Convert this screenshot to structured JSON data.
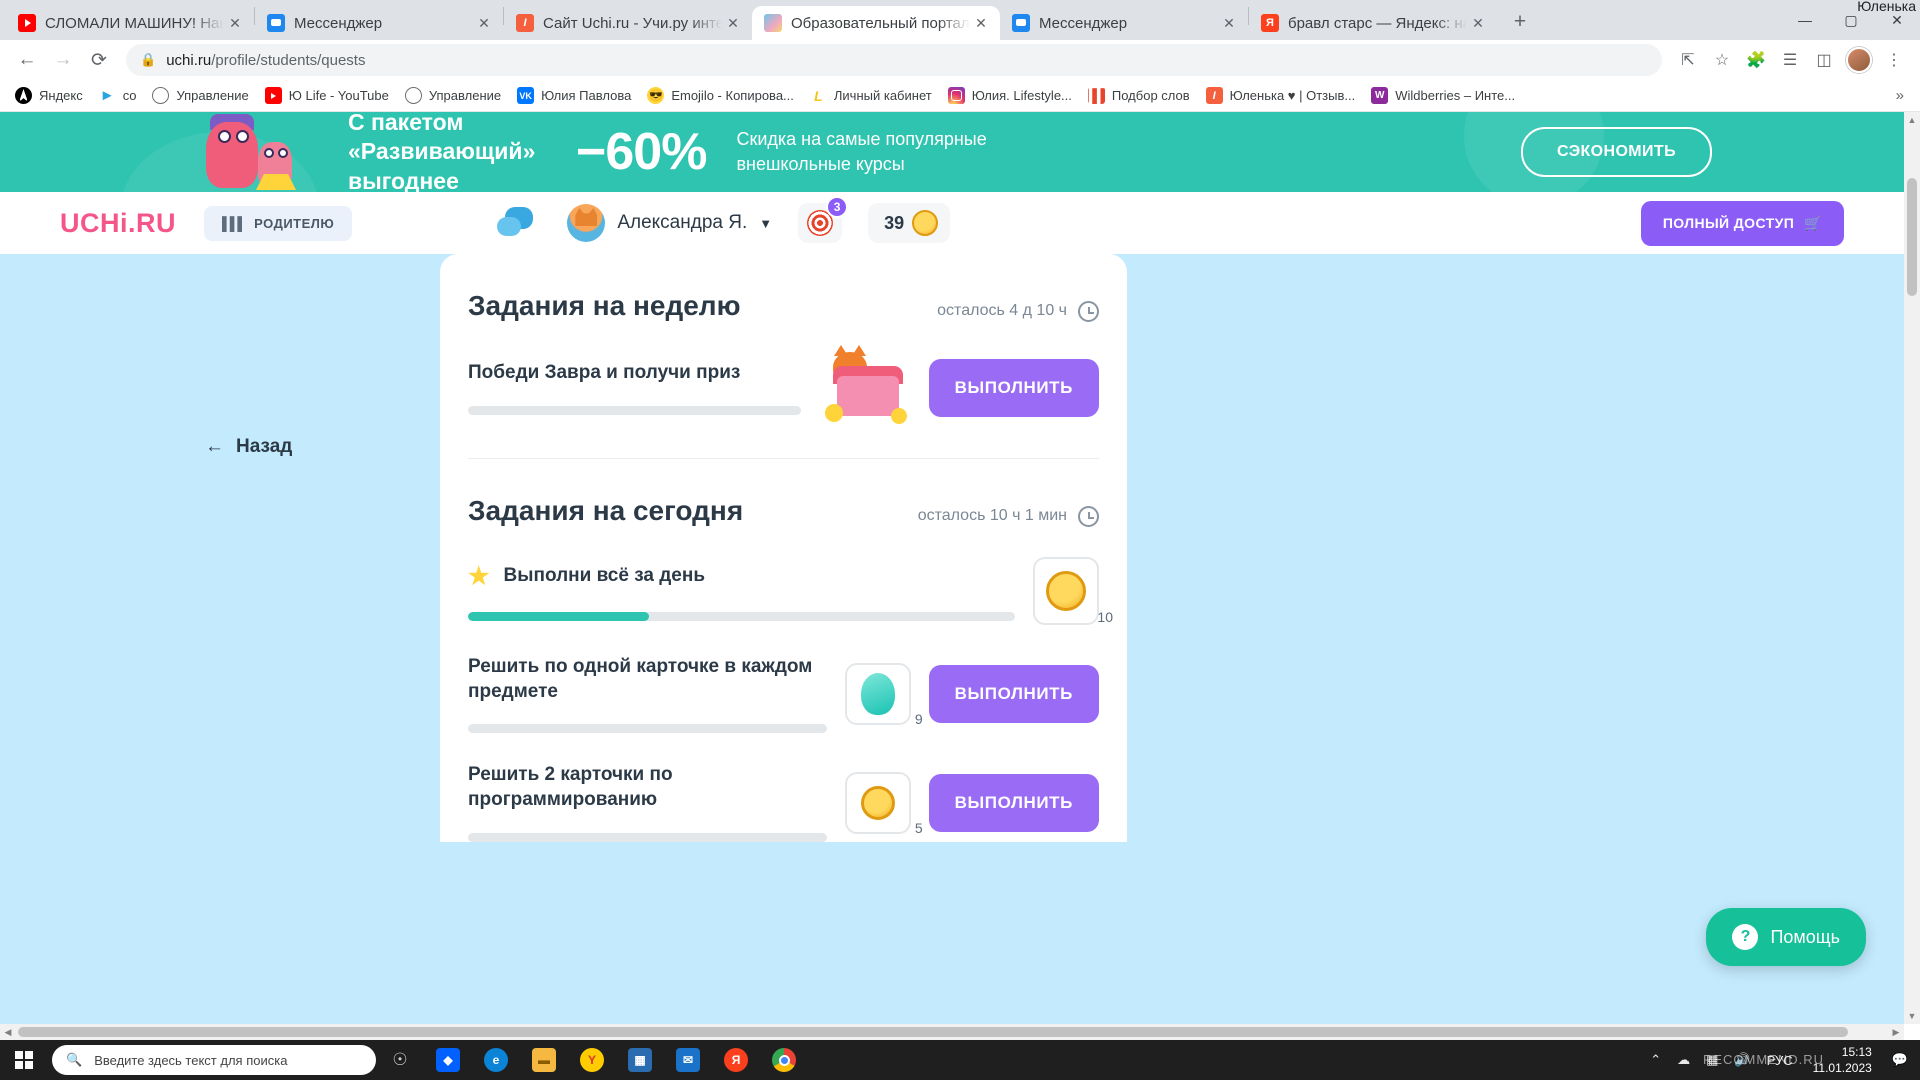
{
  "browser": {
    "tabs": [
      {
        "title": "СЛОМАЛИ МАШИНУ! Наш",
        "favicon": "youtube-icon",
        "active": false
      },
      {
        "title": "Мессенджер",
        "favicon": "messenger-icon",
        "active": false
      },
      {
        "title": "Сайт Uchi.ru - Учи.ру интер",
        "favicon": "uchi-icon",
        "active": false
      },
      {
        "title": "Образовательный портал",
        "favicon": "portal-icon",
        "active": true
      },
      {
        "title": "Мессенджер",
        "favicon": "messenger-icon",
        "active": false
      },
      {
        "title": "бравл старс — Яндекс: на",
        "favicon": "yandex-icon",
        "active": false
      }
    ],
    "new_tab_label": "+",
    "close_label": "✕",
    "window_user": "Юленька",
    "window_controls": {
      "minimize": "—",
      "maximize": "▢",
      "close": "✕"
    },
    "nav": {
      "back": "←",
      "forward": "→",
      "reload": "⟳"
    },
    "url": {
      "lock": "🔒",
      "host": "uchi.ru",
      "path": "/profile/students/quests"
    },
    "omnibox_icons": [
      "share-icon",
      "bookmark-star-icon",
      "extensions-icon",
      "reading-list-icon",
      "side-panel-icon",
      "profile-avatar",
      "chrome-menu-icon"
    ],
    "bookmarks": [
      {
        "label": "Яндекс",
        "icon": "yandex-black-icon"
      },
      {
        "label": "co",
        "icon": "telegram-icon"
      },
      {
        "label": "Управление",
        "icon": "globe-icon"
      },
      {
        "label": "Ю Life - YouTube",
        "icon": "youtube-icon"
      },
      {
        "label": "Управление",
        "icon": "globe-icon"
      },
      {
        "label": "Юлия Павлова",
        "icon": "vk-icon"
      },
      {
        "label": "Emojilo - Копирова...",
        "icon": "emoji-icon"
      },
      {
        "label": "Личный кабинет",
        "icon": "lk-icon"
      },
      {
        "label": "Юлия. Lifestyle...",
        "icon": "instagram-icon"
      },
      {
        "label": "Подбор слов",
        "icon": "wordstat-icon"
      },
      {
        "label": "Юленька ♥ | Отзыв...",
        "icon": "uchi-icon"
      },
      {
        "label": "Wildberries – Инте...",
        "icon": "wildberries-icon"
      }
    ],
    "bookmarks_overflow": "»"
  },
  "promo": {
    "line1": "С пакетом",
    "line2": "«Развивающий»",
    "line3": "выгоднее",
    "discount": "−60%",
    "desc_line1": "Скидка на самые популярные",
    "desc_line2": "внешкольные курсы",
    "button": "СЭКОНОМИТЬ",
    "bg_color": "#2ec4b0"
  },
  "site_header": {
    "logo": "UCHi.RU",
    "parent_button": "РОДИТЕЛЮ",
    "user_name": "Александра Я.",
    "target_badge": "3",
    "coins": "39",
    "full_access_button": "ПОЛНЫЙ ДОСТУП",
    "accent_purple": "#8b5cf6",
    "accent_pink": "#f4568a"
  },
  "page": {
    "back_label": "Назад",
    "back_arrow": "←",
    "sections": [
      {
        "title": "Задания на неделю",
        "time_left": "осталось 4 д 10 ч",
        "quests": [
          {
            "title": "Победи Завра и получи приз",
            "progress": 0,
            "button": "ВЫПОЛНИТЬ",
            "reward_icon": "treasure-chest",
            "reward_count": ""
          }
        ]
      },
      {
        "title": "Задания на сегодня",
        "time_left": "осталось 10 ч 1 мин",
        "quests": [
          {
            "title": "Выполни всё за день",
            "progress": 33,
            "button": "",
            "reward_icon": "coin",
            "reward_count": "10",
            "starred": true
          },
          {
            "title": "Решить по одной карточке в каждом предмете",
            "progress": 0,
            "button": "ВЫПОЛНИТЬ",
            "reward_icon": "gem",
            "reward_count": "9"
          },
          {
            "title": "Решить 2 карточки по программированию",
            "progress": 0,
            "button": "ВЫПОЛНИТЬ",
            "reward_icon": "coin",
            "reward_count": "5"
          }
        ]
      }
    ],
    "help_button": "Помощь",
    "help_icon_glyph": "?"
  },
  "taskbar": {
    "search_placeholder": "Введите здесь текст для поиска",
    "search_icon": "search-icon",
    "start_icon": "windows-start-icon",
    "apps": [
      {
        "name": "cortana-icon",
        "glyph": "",
        "color": "#2b2b2b"
      },
      {
        "name": "dropbox-icon",
        "glyph": "◆",
        "color": "#0061ff"
      },
      {
        "name": "edge-icon",
        "glyph": "e",
        "color": "#0b84d8"
      },
      {
        "name": "file-explorer-icon",
        "glyph": "▤",
        "color": "#f5b942"
      },
      {
        "name": "yandex-browser-icon",
        "glyph": "Y",
        "color": "#ffcc00"
      },
      {
        "name": "store-icon",
        "glyph": "▩",
        "color": "#2b6cb0"
      },
      {
        "name": "mail-icon",
        "glyph": "✉",
        "color": "#1a73c8"
      },
      {
        "name": "yandex-icon",
        "glyph": "Я",
        "color": "#fc3f1d"
      },
      {
        "name": "chrome-icon",
        "glyph": "◉",
        "color": "#1a73e8"
      }
    ],
    "tray_up": "⌃",
    "tray_icons": [
      "onedrive-icon",
      "network-icon",
      "volume-icon"
    ],
    "language": "РУС",
    "time": "15:13",
    "date": "11.01.2023",
    "watermark": "RECOMMEND.RU"
  }
}
